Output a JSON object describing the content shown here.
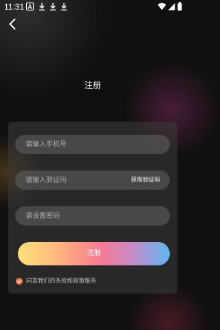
{
  "status_bar": {
    "time": "11:31",
    "icons": [
      "notification-a-icon",
      "download-icon",
      "download-icon",
      "download-icon",
      "wifi-icon",
      "signal-icon",
      "battery-icon"
    ]
  },
  "header": {
    "back_icon": "chevron-left-icon",
    "title": "注册"
  },
  "form": {
    "phone_placeholder": "请输入手机号",
    "code_placeholder": "请输入验证码",
    "get_code_label": "获取验证码",
    "password_placeholder": "请设置密码",
    "submit_label": "注册",
    "agreement_text": "同意我们的条款和政策服务",
    "agreement_checked": true
  },
  "colors": {
    "accent_orange": "#ee7744",
    "button_gradient": [
      "#ffe17a",
      "#f57a93",
      "#5eb6f3"
    ],
    "background": "#101010"
  }
}
